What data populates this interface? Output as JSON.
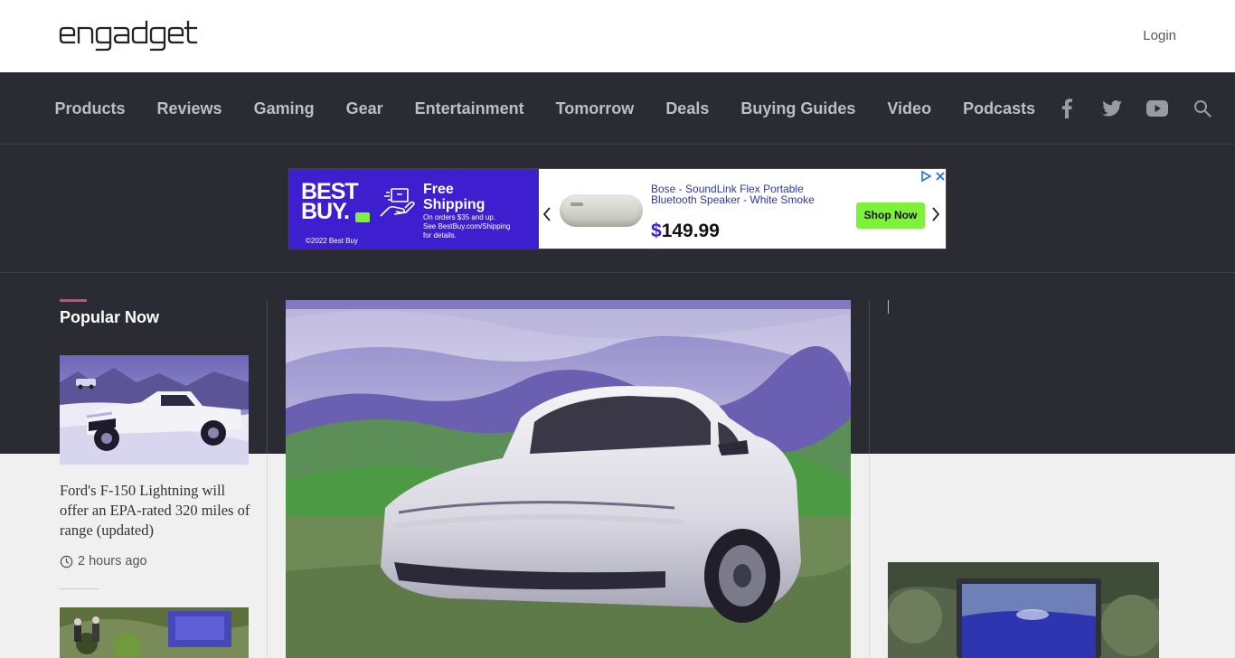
{
  "header": {
    "brand": "engadget",
    "login_label": "Login"
  },
  "nav": {
    "items": [
      "Products",
      "Reviews",
      "Gaming",
      "Gear",
      "Entertainment",
      "Tomorrow",
      "Deals",
      "Buying Guides",
      "Video",
      "Podcasts"
    ],
    "social_icons": [
      "facebook-icon",
      "twitter-icon",
      "youtube-icon",
      "search-icon"
    ]
  },
  "ad": {
    "brand_line1": "BEST",
    "brand_line2": "BUY.",
    "headline_line1": "Free",
    "headline_line2": "Shipping",
    "fine_print_line1": "On orders $35 and up.",
    "fine_print_line2": "See BestBuy.com/Shipping",
    "fine_print_line3": "for details.",
    "copyright": "©2022 Best Buy",
    "product_line1": "Bose - SoundLink Flex Portable",
    "product_line2": "Bluetooth Speaker - White Smoke",
    "price_symbol": "$",
    "price": "149.99",
    "cta": "Shop Now"
  },
  "popular": {
    "title": "Popular Now",
    "stories": [
      {
        "title": "Ford's F-150 Lightning will offer an EPA-rated 320 miles of range (updated)",
        "time": "2 hours ago"
      }
    ]
  },
  "colors": {
    "nav_bg": "#2b2b33",
    "accent": "#c4527f",
    "ad_blue": "#3e1fd0",
    "ad_green": "#7ef23a"
  }
}
